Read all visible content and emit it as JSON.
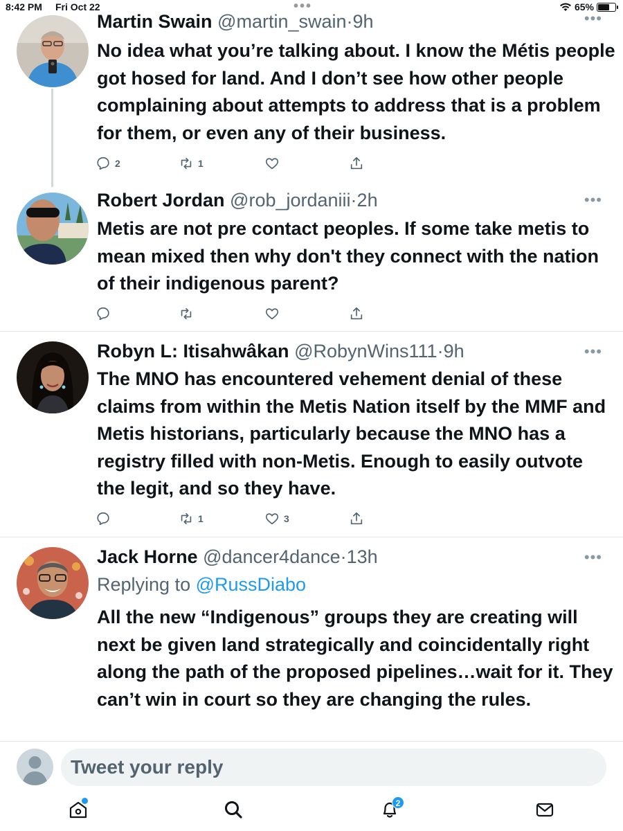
{
  "status_bar": {
    "time": "8:42 PM",
    "date": "Fri Oct 22",
    "battery_percent": "65%",
    "battery_level": 0.65,
    "wifi_icon": "wifi-icon"
  },
  "tweets": [
    {
      "name": "Martin Swain",
      "handle": "@martin_swain",
      "separator": "·",
      "time_ago": "9h",
      "text": "No idea what you’re talking about. I know the Métis people got hosed for land. And I don’t see how other people complaining about attempts to address that is a problem for them, or even any of their business.",
      "replies": "2",
      "retweets": "1",
      "likes": ""
    },
    {
      "name": "Robert Jordan",
      "handle": "@rob_jordaniii",
      "separator": "·",
      "time_ago": "2h",
      "text": "Metis are not pre contact peoples. If some take metis to mean mixed then why don't they connect with the nation of their indigenous parent?",
      "replies": "",
      "retweets": "",
      "likes": ""
    },
    {
      "name": "Robyn L: Itisahwâkan",
      "handle": "@RobynWins111",
      "separator": "·",
      "time_ago": "9h",
      "text": "The MNO has encountered vehement denial of these claims from within the Metis Nation itself by the MMF and Metis historians, particularly because the MNO has a registry filled with non-Metis. Enough to easily outvote the legit, and so they have.",
      "replies": "",
      "retweets": "1",
      "likes": "3"
    },
    {
      "name": "Jack Horne",
      "handle": "@dancer4dance",
      "separator": "·",
      "time_ago": "13h",
      "replying_label": "Replying to",
      "replying_to": "@RussDiabo",
      "text": "All the new “Indigenous” groups they are creating will next be given land strategically and coincidentally right along the path of the proposed pipelines…wait for it. They can’t win in court so they are changing the rules."
    }
  ],
  "reply_bar": {
    "placeholder": "Tweet your reply"
  },
  "tab_bar": {
    "notifications_badge": "2",
    "icons": [
      "home-icon",
      "search-icon",
      "bell-icon",
      "mail-icon"
    ]
  },
  "colors": {
    "accent": "#1d9bf0",
    "text": "#0f1419",
    "secondary": "#536471",
    "divider": "#e1e8ed"
  }
}
